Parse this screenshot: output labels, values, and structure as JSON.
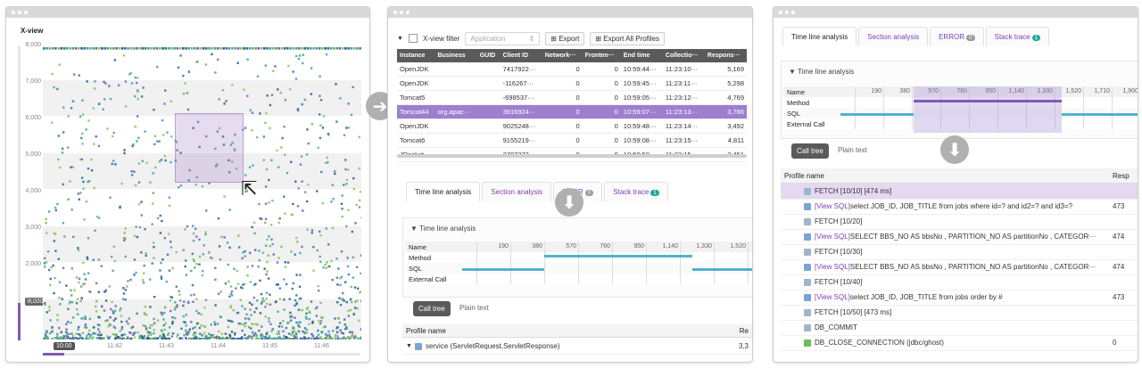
{
  "colors": {
    "accent": "#7d5ab6",
    "tab_link": "#7d3fb3",
    "sql_bar": "#4fb3cf",
    "method_bar": "#7d5ab6",
    "teal_badge": "#1eaa9c",
    "gray_badge": "#999999"
  },
  "xview": {
    "title": "X-view",
    "y_ticks": [
      "8,000",
      "7,000",
      "6,000",
      "5,000",
      "4,000",
      "3,000",
      "2,000",
      "1,000"
    ],
    "x_ticks": [
      "10:00",
      "11:42",
      "11:43",
      "11:44",
      "11:45",
      "11:46"
    ],
    "slider_value": "8,000",
    "time_badge": "10:00"
  },
  "arrows": {
    "right": "➔",
    "down": "⬇"
  },
  "toolbar": {
    "filter_label": "X-view filter",
    "select_value": "Application",
    "select_arrow": "⇕",
    "export_label": "Export",
    "export_all_label": "Export All Profiles",
    "filter_arrow": "▼",
    "export_icon": "⊞"
  },
  "instances": {
    "headers": [
      "Instance",
      "Business",
      "GUID",
      "Client ID",
      "Network···",
      "Fronten···",
      "End time",
      "Collectio···",
      "Respons···"
    ],
    "rows": [
      [
        "OpenJDK",
        "",
        "",
        "7417922···",
        "0",
        "0",
        "10:59:44···",
        "11:23:10···",
        "5,169"
      ],
      [
        "OpenJDK",
        "",
        "",
        "-116267···",
        "0",
        "0",
        "10:59:45···",
        "11:23:11···",
        "5,298"
      ],
      [
        "Tomcat5",
        "",
        "",
        "-698537···",
        "0",
        "0",
        "10:59:05···",
        "11:23:12···",
        "4,769"
      ],
      [
        "Tomcat44",
        "org.apac···",
        "",
        "3916924···",
        "0",
        "0",
        "10:59:07···",
        "11:23:13···",
        "3,786"
      ],
      [
        "OpenJDK",
        "",
        "",
        "9025248···",
        "0",
        "0",
        "10:59:48···",
        "11:23:14···",
        "3,492"
      ],
      [
        "Tomcat6",
        "",
        "",
        "9155219···",
        "0",
        "0",
        "10:59:08···",
        "11:23:15···",
        "4,811"
      ],
      [
        "JRocket",
        "",
        "",
        "2797373···",
        "0",
        "0",
        "10:59:50···",
        "11:23:15···",
        "3,451"
      ]
    ]
  },
  "tabs": {
    "timeline": "Time line analysis",
    "section": "Section analysis",
    "error": "ERROR",
    "error_count": "0",
    "error_partial": "RROR",
    "stack": "Stack trace",
    "stack_count": "1"
  },
  "timeline": {
    "title": "Time line analysis",
    "title_arrow": "▼",
    "columns": [
      "190",
      "380",
      "570",
      "760",
      "950",
      "1,140",
      "1,330",
      "1,520",
      "1,710",
      "1,900"
    ],
    "rows": [
      "Name",
      "Method",
      "SQL",
      "External Call"
    ]
  },
  "calltree": {
    "button": "Call tree",
    "plain_text": "Plain text"
  },
  "profile_mid": {
    "header": "Profile name",
    "header_right": "Re",
    "row_label": "service (ServletRequest,ServletResponse)",
    "row_value": "3,3",
    "row_arrow": "▼"
  },
  "profile_right": {
    "header": "Profile name",
    "header_right": "Resp",
    "rows": [
      {
        "kind": "fetch",
        "text": "FETCH [10/10] [474 ms]",
        "value": ""
      },
      {
        "kind": "sql",
        "tag": "[View SQL]",
        "text": " select JOB_ID, JOB_TITLE from jobs where id=? and id2=? and id3=?",
        "value": "473"
      },
      {
        "kind": "fetch",
        "text": "FETCH [10/20]",
        "value": ""
      },
      {
        "kind": "sql",
        "tag": "[View SQL]",
        "text": " SELECT BBS_NO AS bbsNo , PARTITION_NO AS partitionNo , CATEGOR···",
        "value": "474"
      },
      {
        "kind": "fetch",
        "text": "FETCH [10/30]",
        "value": ""
      },
      {
        "kind": "sql",
        "tag": "[View SQL]",
        "text": " SELECT BBS_NO AS bbsNo , PARTITION_NO AS partitionNo , CATEGOR···",
        "value": "474"
      },
      {
        "kind": "fetch",
        "text": "FETCH [10/40]",
        "value": ""
      },
      {
        "kind": "sql",
        "tag": "[View SQL]",
        "text": " select JOB_ID, JOB_TITLE from jobs order by #",
        "value": "473"
      },
      {
        "kind": "fetch",
        "text": "FETCH [10/50] [473 ms]",
        "value": ""
      },
      {
        "kind": "db",
        "text": "DB_COMMIT",
        "value": ""
      },
      {
        "kind": "db2",
        "text": "DB_CLOSE_CONNECTION (jdbc/ghost)",
        "value": "0"
      }
    ]
  }
}
